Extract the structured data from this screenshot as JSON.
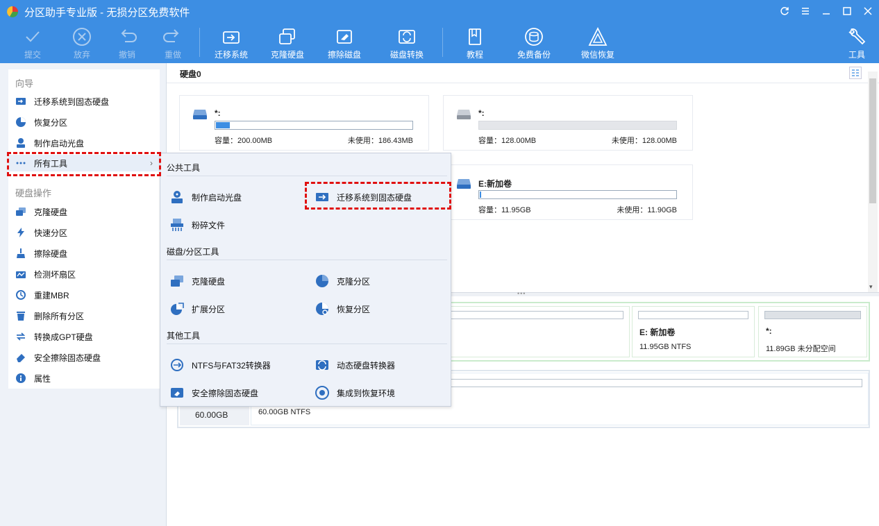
{
  "window": {
    "title": "分区助手专业版 - 无损分区免费软件"
  },
  "toolbar": {
    "commit": "提交",
    "discard": "放弃",
    "undo": "撤销",
    "redo": "重做",
    "migrate_os": "迁移系统",
    "clone_disk": "克隆硬盘",
    "wipe_disk": "擦除磁盘",
    "disk_convert": "磁盘转换",
    "tutorial": "教程",
    "free_backup": "免费备份",
    "wechat_recover": "微信恢复",
    "tools": "工具"
  },
  "sidebar": {
    "wizard_heading": "向导",
    "wizard_items": [
      "迁移系统到固态硬盘",
      "恢复分区",
      "制作启动光盘",
      "所有工具"
    ],
    "disk_ops_heading": "硬盘操作",
    "disk_items": [
      "克隆硬盘",
      "快速分区",
      "擦除硬盘",
      "检测坏扇区",
      "重建MBR",
      "删除所有分区",
      "转换成GPT硬盘",
      "安全擦除固态硬盘",
      "属性"
    ]
  },
  "popup": {
    "public_heading": "公共工具",
    "public_items": [
      "制作启动光盘",
      "迁移系统到固态硬盘",
      "粉碎文件"
    ],
    "partition_heading": "磁盘/分区工具",
    "partition_items": [
      "克隆硬盘",
      "克隆分区",
      "扩展分区",
      "恢复分区"
    ],
    "other_heading": "其他工具",
    "other_items": [
      "NTFS与FAT32转换器",
      "动态硬盘转换器",
      "安全擦除固态硬盘",
      "集成到恢复环境"
    ]
  },
  "main": {
    "disk_title": "硬盘0",
    "cards": [
      {
        "name": "*:",
        "capacity": "容量：200.00MB",
        "free": "未使用：186.43MB",
        "used_fraction": 0.07
      },
      {
        "name": "*:",
        "capacity": "容量：128.00MB",
        "free": "未使用：128.00MB",
        "used_fraction": 0.0
      },
      {
        "name": "E:新加卷",
        "capacity": "容量：11.95GB",
        "free": "未使用：11.90GB",
        "used_fraction": 0.004
      }
    ],
    "disk0_partitions": [
      {
        "name": "E: 新加卷",
        "info": "11.95GB NTFS"
      },
      {
        "name": "*:",
        "info": "11.89GB 未分配空间"
      }
    ],
    "disk1": {
      "size": "60.00GB",
      "info": "60.00GB NTFS"
    }
  }
}
